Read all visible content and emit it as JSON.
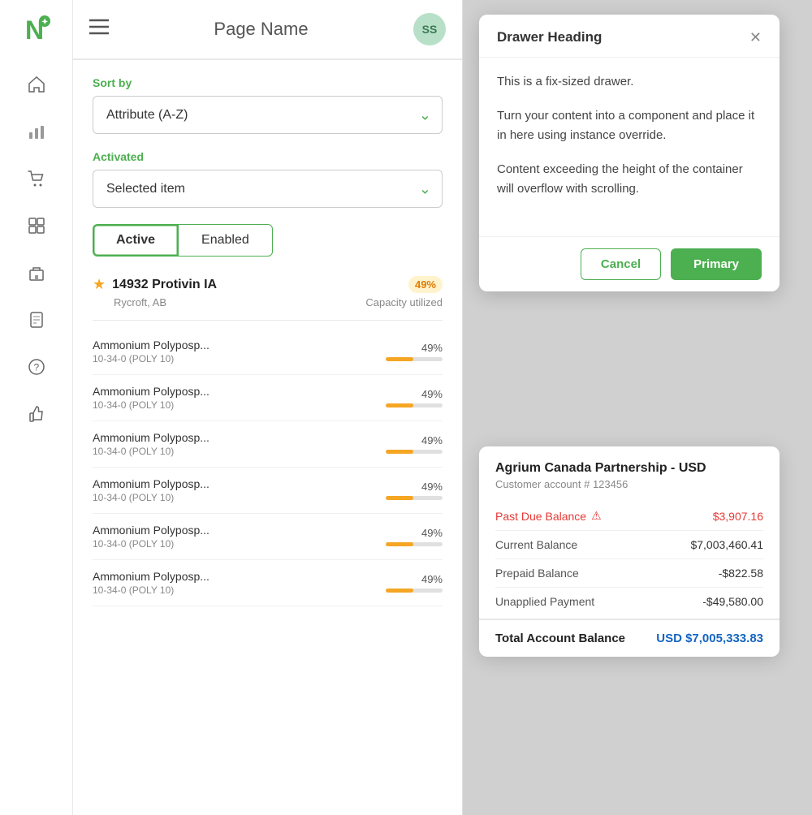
{
  "sidebar": {
    "logo_text": "N",
    "icons": [
      {
        "name": "home-icon",
        "symbol": "⌂"
      },
      {
        "name": "chart-icon",
        "symbol": "⌐"
      },
      {
        "name": "cart-icon",
        "symbol": "⊟"
      },
      {
        "name": "grid-icon",
        "symbol": "▦"
      },
      {
        "name": "building-icon",
        "symbol": "⊞"
      },
      {
        "name": "document-icon",
        "symbol": "⊡"
      },
      {
        "name": "help-icon",
        "symbol": "?"
      },
      {
        "name": "thumb-icon",
        "symbol": "👍"
      }
    ]
  },
  "header": {
    "title": "Page Name",
    "avatar": "SS"
  },
  "filters": {
    "sort_by_label": "Sort by",
    "sort_by_value": "Attribute (A-Z)",
    "activated_label": "Activated",
    "activated_value": "Selected item",
    "toggle_active": "Active",
    "toggle_enabled": "Enabled"
  },
  "featured": {
    "name": "14932 Protivin IA",
    "location": "Rycroft, AB",
    "capacity_pct": "49%",
    "capacity_label": "Capacity utilized"
  },
  "products": [
    {
      "name": "Ammonium Polyposp...",
      "code": "10-34-0 (POLY 10)",
      "pct": "49%",
      "fill": 49
    },
    {
      "name": "Ammonium Polyposp...",
      "code": "10-34-0 (POLY 10)",
      "pct": "49%",
      "fill": 49
    },
    {
      "name": "Ammonium Polyposp...",
      "code": "10-34-0 (POLY 10)",
      "pct": "49%",
      "fill": 49
    },
    {
      "name": "Ammonium Polyposp...",
      "code": "10-34-0 (POLY 10)",
      "pct": "49%",
      "fill": 49
    },
    {
      "name": "Ammonium Polyposp...",
      "code": "10-34-0 (POLY 10)",
      "pct": "49%",
      "fill": 49
    },
    {
      "name": "Ammonium Polyposp...",
      "code": "10-34-0 (POLY 10)",
      "pct": "49%",
      "fill": 49
    }
  ],
  "drawer": {
    "title": "Drawer Heading",
    "line1": "This is a fix-sized drawer.",
    "line2": "Turn your content into a component and place it in here using instance override.",
    "line3": "Content exceeding the height of the container will overflow with scrolling.",
    "cancel_label": "Cancel",
    "primary_label": "Primary"
  },
  "account": {
    "title": "Agrium Canada Partnership - USD",
    "subtitle": "Customer account # 123456",
    "rows": [
      {
        "label": "Past Due Balance",
        "value": "$3,907.16",
        "is_past_due": true
      },
      {
        "label": "Current Balance",
        "value": "$7,003,460.41",
        "is_past_due": false
      },
      {
        "label": "Prepaid Balance",
        "value": "-$822.58",
        "is_past_due": false
      },
      {
        "label": "Unapplied Payment",
        "value": "-$49,580.00",
        "is_past_due": false
      }
    ],
    "total_label": "Total Account Balance",
    "total_value": "USD $7,005,333.83"
  }
}
